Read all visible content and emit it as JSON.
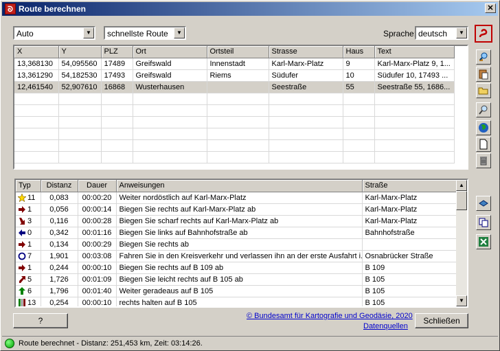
{
  "window": {
    "title": "Route berechnen",
    "close_glyph": "✕",
    "app_icon_glyph": "ᘐ"
  },
  "controls": {
    "vehicle": "Auto",
    "route_type": "schnellste Route",
    "language_label": "Sprache:",
    "language": "deutsch"
  },
  "stops": {
    "headers": [
      "X",
      "Y",
      "PLZ",
      "Ort",
      "Ortsteil",
      "Strasse",
      "Haus",
      "Text"
    ],
    "rows": [
      [
        "13,368130",
        "54,095560",
        "17489",
        "Greifswald",
        "Innenstadt",
        "Karl-Marx-Platz",
        "9",
        "Karl-Marx-Platz 9, 1..."
      ],
      [
        "13,361290",
        "54,182530",
        "17493",
        "Greifswald",
        "Riems",
        "Südufer",
        "10",
        "Südufer 10, 17493 ..."
      ],
      [
        "12,461540",
        "52,907610",
        "16868",
        "Wusterhausen",
        "",
        "Seestraße",
        "55",
        "Seestraße 55, 1686..."
      ]
    ],
    "selected_row": 2
  },
  "directions": {
    "headers": [
      "Typ",
      "Distanz",
      "Dauer",
      "Anweisungen",
      "Straße"
    ],
    "rows": [
      {
        "icon": "start-star-icon",
        "typ": "11",
        "distanz": "0,083",
        "dauer": "00:00:20",
        "text": "Weiter nordöstlich auf Karl-Marx-Platz",
        "strasse": "Karl-Marx-Platz"
      },
      {
        "icon": "turn-right-icon",
        "typ": "1",
        "distanz": "0,056",
        "dauer": "00:00:14",
        "text": "Biegen Sie rechts auf Karl-Marx-Platz ab",
        "strasse": "Karl-Marx-Platz"
      },
      {
        "icon": "sharp-right-icon",
        "typ": "3",
        "distanz": "0,116",
        "dauer": "00:00:28",
        "text": "Biegen Sie scharf rechts auf Karl-Marx-Platz ab",
        "strasse": "Karl-Marx-Platz"
      },
      {
        "icon": "turn-left-icon",
        "typ": "0",
        "distanz": "0,342",
        "dauer": "00:01:16",
        "text": "Biegen Sie links auf Bahnhofstraße ab",
        "strasse": "Bahnhofstraße"
      },
      {
        "icon": "turn-right-icon",
        "typ": "1",
        "distanz": "0,134",
        "dauer": "00:00:29",
        "text": "Biegen Sie rechts ab",
        "strasse": ""
      },
      {
        "icon": "roundabout-icon",
        "typ": "7",
        "distanz": "1,901",
        "dauer": "00:03:08",
        "text": "Fahren Sie in den Kreisverkehr und verlassen ihn an der erste Ausfahrt i...",
        "strasse": "Osnabrücker Straße"
      },
      {
        "icon": "turn-right-icon",
        "typ": "1",
        "distanz": "0,244",
        "dauer": "00:00:10",
        "text": "Biegen Sie rechts auf B 109 ab",
        "strasse": "B 109"
      },
      {
        "icon": "slight-right-icon",
        "typ": "5",
        "distanz": "1,726",
        "dauer": "00:01:09",
        "text": "Biegen Sie leicht rechts auf B 105 ab",
        "strasse": "B 105"
      },
      {
        "icon": "straight-icon",
        "typ": "6",
        "distanz": "1,796",
        "dauer": "00:01:40",
        "text": "Weiter geradeaus auf B 105",
        "strasse": "B 105"
      },
      {
        "icon": "keep-right-icon",
        "typ": "13",
        "distanz": "0,254",
        "dauer": "00:00:10",
        "text": "rechts halten auf B 105",
        "strasse": "B 105"
      }
    ]
  },
  "footer": {
    "help_label": "?",
    "copyright_link": "© Bundesamt für Kartografie und Geodäsie, 2020",
    "sources_link": "Datenquellen",
    "close_label": "Schließen"
  },
  "status": {
    "text": "Route berechnet - Distanz: 251,453 km, Zeit: 03:14:26."
  },
  "colors": {
    "title_start": "#0a246a",
    "title_end": "#a6caf0",
    "status_green": "#00a000",
    "arrow_red": "#800000",
    "arrow_blue": "#000080",
    "arrow_green": "#008000"
  }
}
